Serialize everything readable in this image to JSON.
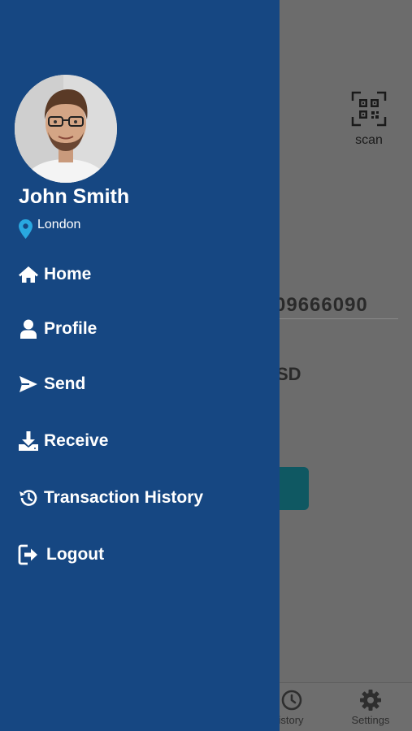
{
  "background": {
    "scan_label": "scan",
    "account_number_partial": "09666090",
    "currency_partial": "SD",
    "tabs": [
      {
        "label": "istory",
        "icon": "history-icon"
      },
      {
        "label": "Settings",
        "icon": "gear-icon"
      }
    ]
  },
  "drawer": {
    "user": {
      "name": "John Smith",
      "location": "London"
    },
    "menu": [
      {
        "label": "Home",
        "icon": "home-icon"
      },
      {
        "label": "Profile",
        "icon": "user-icon"
      },
      {
        "label": "Send",
        "icon": "send-icon"
      },
      {
        "label": "Receive",
        "icon": "receive-icon"
      },
      {
        "label": "Transaction History",
        "icon": "history-icon"
      },
      {
        "label": "Logout",
        "icon": "logout-icon"
      }
    ]
  },
  "colors": {
    "drawer_bg": "#164782",
    "overlay_bg": "#6c6c6c",
    "pin_color": "#29a8e0",
    "button_bg": "#0f5862"
  }
}
